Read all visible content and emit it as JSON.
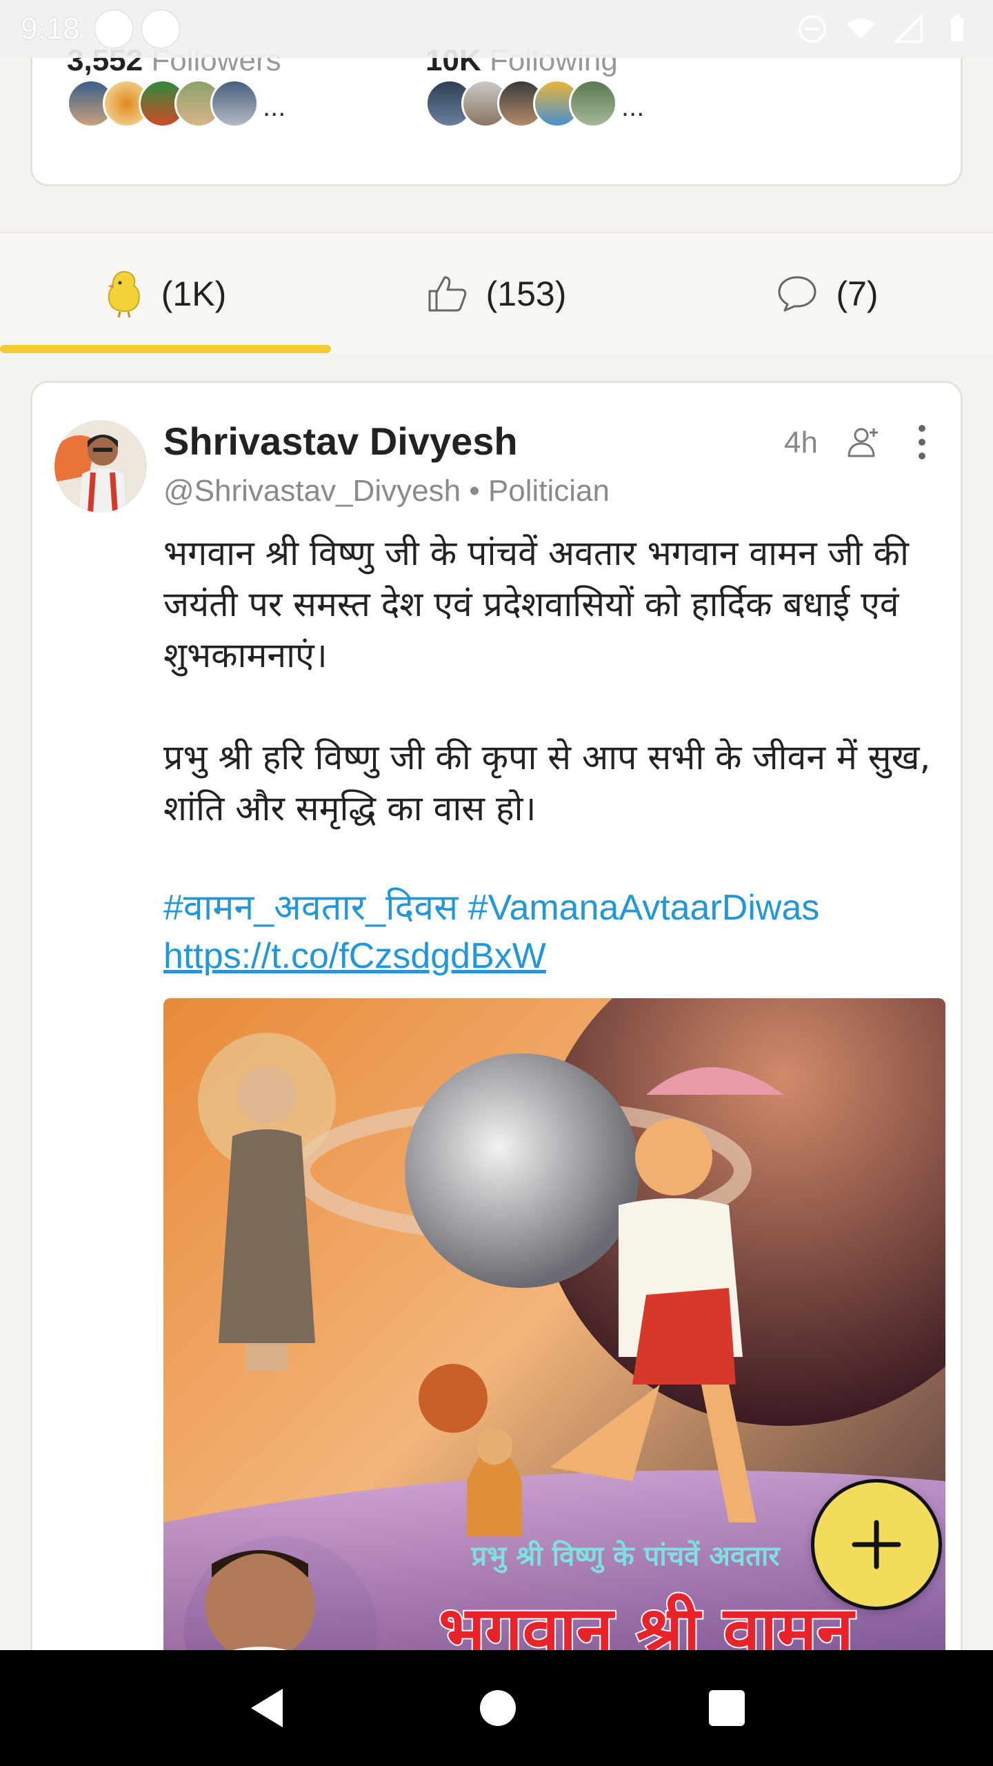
{
  "status_bar": {
    "time": "9:18"
  },
  "profile_stats": {
    "followers_count": "3,552",
    "followers_label": "Followers",
    "following_count": "10K",
    "following_label": "Following",
    "more": "..."
  },
  "tabs": [
    {
      "label": "(1K)",
      "icon": "chick-icon",
      "active": true
    },
    {
      "label": "(153)",
      "icon": "thumbs-up-icon",
      "active": false
    },
    {
      "label": "(7)",
      "icon": "comment-icon",
      "active": false
    }
  ],
  "post": {
    "author_name": "Shrivastav Divyesh",
    "handle_meta": "@Shrivastav_Divyesh • Politician",
    "time": "4h",
    "paragraph1": "भगवान श्री विष्णु जी के पांचवें अवतार भगवान वामन जी की जयंती पर समस्त देश एवं प्रदेशवासियों को हार्दिक बधाई एवं शुभकामनाएं।",
    "paragraph2": "प्रभु श्री हरि विष्णु जी की कृपा से आप सभी के जीवन में सुख, शांति और समृद्धि का वास हो।",
    "hashtags": "#वामन_अवतार_दिवस #VamanaAvtaarDiwas",
    "link": "https://t.co/fCzsdgdBxW",
    "image_caption_small": "प्रभु श्री विष्णु के पांचवें अवतार",
    "image_caption_large": "भगवान श्री वामन"
  },
  "colors": {
    "accent": "#f3cc35",
    "link": "#2196d9",
    "fab": "#f3dc5b"
  }
}
